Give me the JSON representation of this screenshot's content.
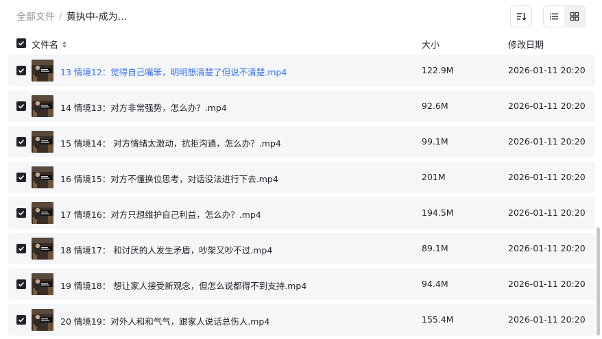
{
  "breadcrumb": {
    "root": "全部文件",
    "separator": "/",
    "current": "黄执中-成为..."
  },
  "toolbar": {
    "sort_icon": "sort-icon",
    "list_icon": "list-view-icon",
    "grid_icon": "grid-view-icon"
  },
  "header": {
    "name": "文件名",
    "size": "大小",
    "date": "修改日期"
  },
  "colors": {
    "link": "#3370ff",
    "row_bg": "#f5f6f7",
    "checkbox": "#1f2329"
  },
  "files": [
    {
      "name": "13 情境12：觉得自己嘴笨，明明想清楚了但说不清楚.mp4",
      "size": "122.9M",
      "date": "2026-01-11 20:20",
      "highlight": true
    },
    {
      "name": "14 情境13：对方非常强势，怎么办？.mp4",
      "size": "92.6M",
      "date": "2026-01-11 20:20",
      "highlight": false
    },
    {
      "name": "15 情境14： 对方情绪太激动，抗拒沟通，怎么办？.mp4",
      "size": "99.1M",
      "date": "2026-01-11 20:20",
      "highlight": false
    },
    {
      "name": "16 情境15：对方不懂换位思考，对话没法进行下去.mp4",
      "size": "201M",
      "date": "2026-01-11 20:20",
      "highlight": false
    },
    {
      "name": "17 情境16：对方只想维护自己利益，怎么办？.mp4",
      "size": "194.5M",
      "date": "2026-01-11 20:20",
      "highlight": false
    },
    {
      "name": "18 情境17： 和讨厌的人发生矛盾，吵架又吵不过.mp4",
      "size": "89.1M",
      "date": "2026-01-11 20:20",
      "highlight": false
    },
    {
      "name": "19 情境18： 想让家人接受新观念，但怎么说都得不到支持.mp4",
      "size": "94.4M",
      "date": "2026-01-11 20:20",
      "highlight": false
    },
    {
      "name": "20 情境19：对外人和和气气，跟家人说话总伤人.mp4",
      "size": "155.4M",
      "date": "2026-01-11 20:20",
      "highlight": false
    }
  ]
}
